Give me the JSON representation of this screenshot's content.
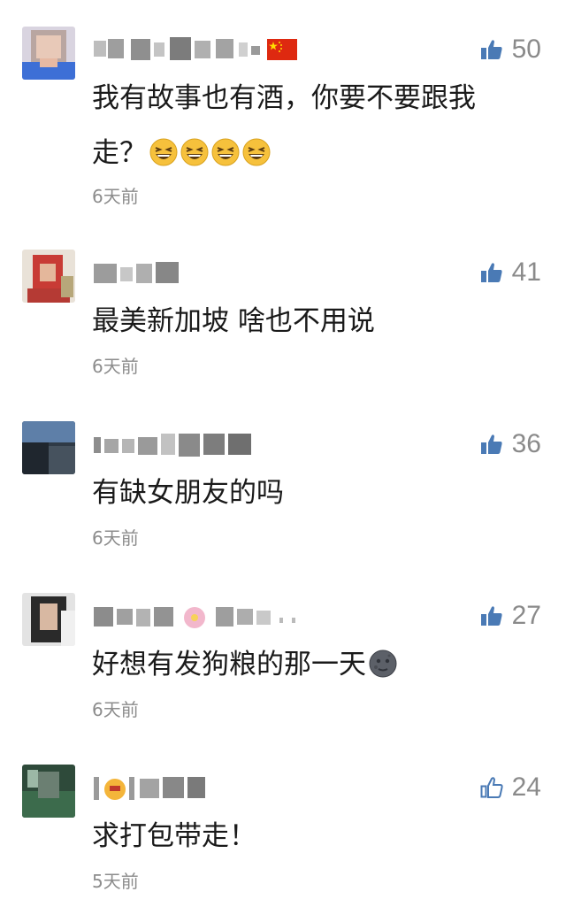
{
  "comments": [
    {
      "like_count": "50",
      "text_line1": "我有故事也有酒，你要不要跟我",
      "text_line2": "走？",
      "emoji": "grinning-squint-face",
      "emoji_count": 4,
      "time": "6天前",
      "flag": "china-flag",
      "username_blurred": true
    },
    {
      "like_count": "41",
      "text": "最美新加坡 啥也不用说",
      "time": "6天前",
      "username_blurred": true
    },
    {
      "like_count": "36",
      "text": "有缺女朋友的吗",
      "time": "6天前",
      "username_blurred": true
    },
    {
      "like_count": "27",
      "text": "好想有发狗粮的那一天",
      "emoji": "new-moon-face",
      "time": "6天前",
      "username_blurred": true
    },
    {
      "like_count": "24",
      "text": "求打包带走！",
      "time": "5天前",
      "username_blurred": true
    }
  ],
  "colors": {
    "like_active": "#4a7ab5",
    "like_count": "#8a8a8a",
    "text": "#1a1a1a",
    "time": "#8c8c8c",
    "emoji": "#f6c13c"
  }
}
